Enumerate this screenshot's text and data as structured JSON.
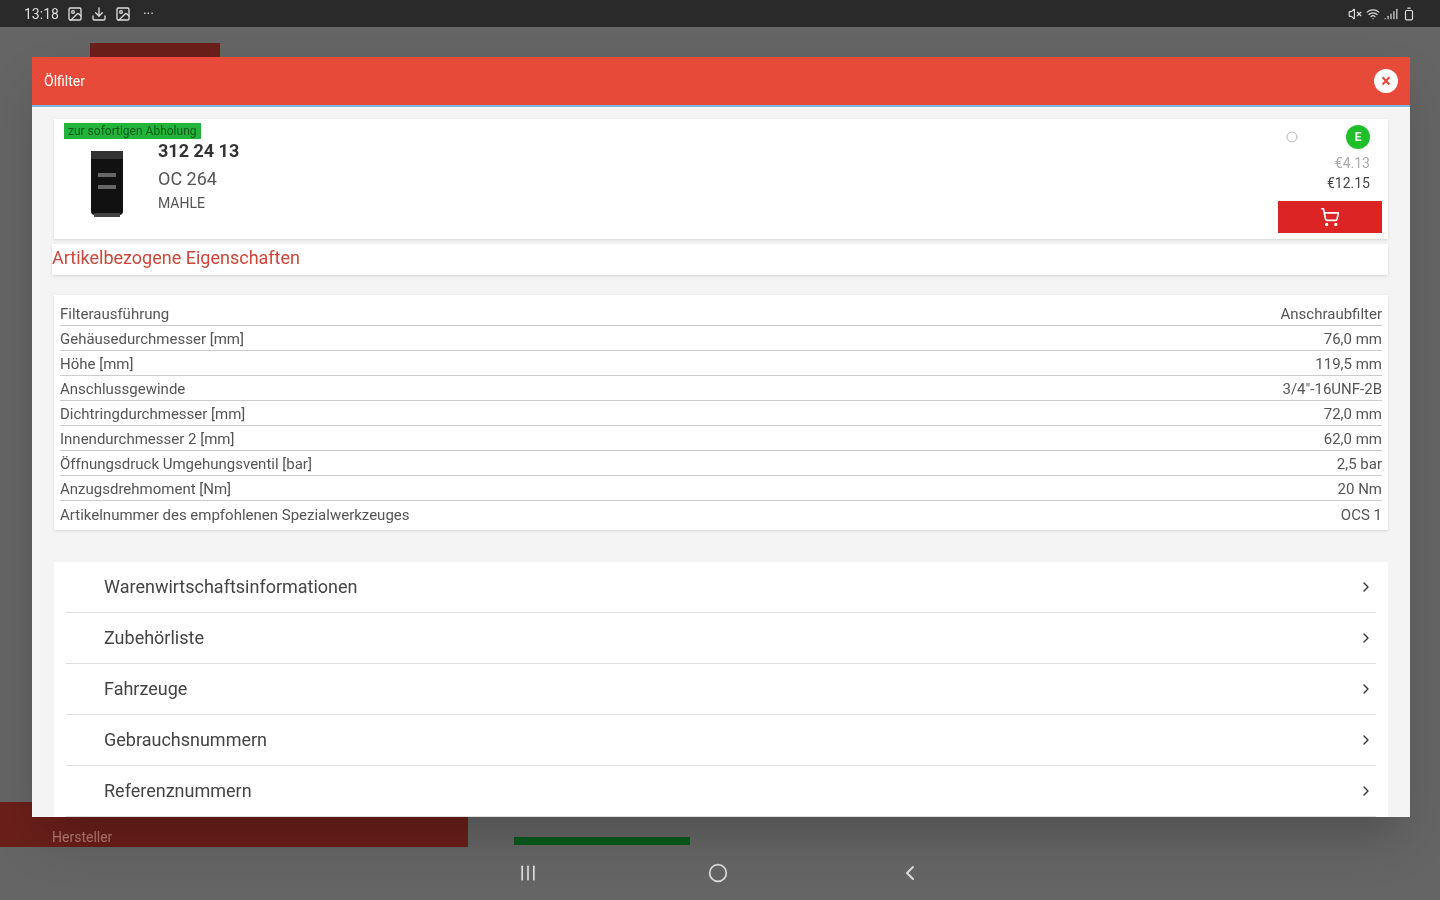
{
  "status_bar": {
    "time": "13:18",
    "more": "···"
  },
  "background": {
    "footer_label": "Hersteller"
  },
  "dialog": {
    "title": "Ölfilter",
    "close": "×"
  },
  "article": {
    "availability": "zur sofortigen Abholung",
    "number": "312 24 13",
    "code": "OC 264",
    "brand": "MAHLE",
    "badge": "E",
    "price_net": "€4.13",
    "price_gross": "€12.15"
  },
  "properties": {
    "title": "Artikelbezogene Eigenschaften",
    "rows": [
      {
        "name": "Filterausführung",
        "value": "Anschraubfilter"
      },
      {
        "name": "Gehäusedurchmesser [mm]",
        "value": "76,0 mm"
      },
      {
        "name": "Höhe [mm]",
        "value": "119,5 mm"
      },
      {
        "name": "Anschlussgewinde",
        "value": "3/4\"-16UNF-2B"
      },
      {
        "name": "Dichtringdurchmesser [mm]",
        "value": "72,0 mm"
      },
      {
        "name": "Innendurchmesser 2 [mm]",
        "value": "62,0 mm"
      },
      {
        "name": "Öffnungsdruck Umgehungsventil [bar]",
        "value": "2,5 bar"
      },
      {
        "name": "Anzugsdrehmoment [Nm]",
        "value": "20 Nm"
      },
      {
        "name": "Artikelnummer des empfohlenen Spezialwerkzeuges",
        "value": "OCS 1"
      }
    ]
  },
  "sections": [
    {
      "label": "Warenwirtschaftsinformationen"
    },
    {
      "label": "Zubehörliste"
    },
    {
      "label": "Fahrzeuge"
    },
    {
      "label": "Gebrauchsnummern"
    },
    {
      "label": "Referenznummern"
    }
  ]
}
